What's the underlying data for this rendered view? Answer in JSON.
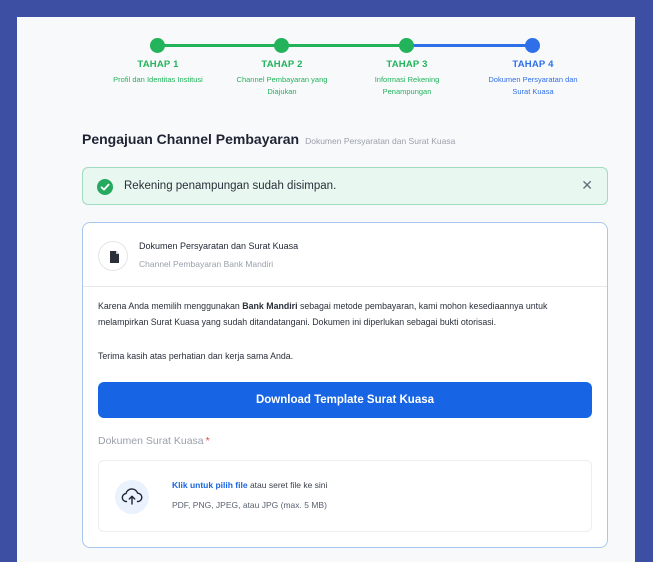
{
  "steps": [
    {
      "title": "TAHAP 1",
      "desc": "Profil dan Identitas Institusi",
      "status": "done"
    },
    {
      "title": "TAHAP 2",
      "desc_line1": "Channel Pembayaran yang",
      "desc_line2": "Diajukan",
      "status": "done"
    },
    {
      "title": "TAHAP 3",
      "desc_line1": "Informasi Rekening",
      "desc_line2": "Penampungan",
      "status": "done"
    },
    {
      "title": "TAHAP 4",
      "desc_line1": "Dokumen Persyaratan dan",
      "desc_line2": "Surat Kuasa",
      "status": "active"
    }
  ],
  "header": {
    "title": "Pengajuan Channel Pembayaran",
    "subtitle": "Dokumen Persyaratan dan Surat Kuasa"
  },
  "alert": {
    "message": "Rekening penampungan sudah disimpan.",
    "close_glyph": "✕"
  },
  "card": {
    "title": "Dokumen Persyaratan dan Surat Kuasa",
    "subtitle": "Channel Pembayaran Bank Mandiri",
    "para_prefix": "Karena Anda memilih menggunakan",
    "para_bank": "Bank Mandiri",
    "para_suffix": "sebagai metode pembayaran, kami mohon kesediaannya untuk melampirkan Surat Kuasa yang sudah ditandatangani. Dokumen ini diperlukan sebagai bukti otorisasi.",
    "thanks": "Terima kasih atas perhatian dan kerja sama Anda.",
    "download_label": "Download Template Surat Kuasa",
    "field_label": "Dokumen Surat Kuasa",
    "required_mark": "*",
    "drop_link": "Klik untuk pilih file",
    "drop_text": "atau seret file ke sini",
    "drop_formats": "PDF, PNG, JPEG, atau JPG (max. 5 MB)"
  },
  "colors": {
    "done": "#22b35b",
    "active": "#2f6fe8",
    "primary": "#1765e4",
    "background": "#3d4fa2"
  },
  "icons": {
    "alert": "check-circle-icon",
    "close": "close-icon",
    "document": "document-icon",
    "upload": "cloud-upload-icon"
  }
}
